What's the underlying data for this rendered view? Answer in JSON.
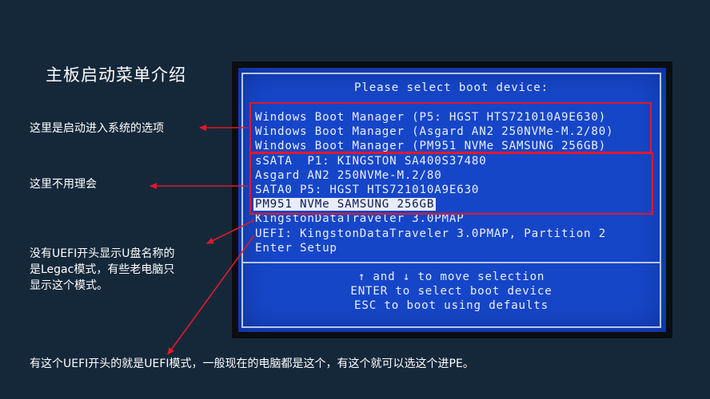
{
  "slide": {
    "title": "主板启动菜单介绍"
  },
  "annotations": {
    "system_options": "这里是启动进入系统的选项",
    "ignore": "这里不用理会",
    "legacy_line1": "没有UEFI开头显示U盘名称的",
    "legacy_line2": "是Legac模式，有些老电脑只",
    "legacy_line3": "显示这个模式。",
    "uefi_note": "有这个UEFI开头的就是UEFI模式，一般现在的电脑都是这个，有这个就可以选这个进PE。"
  },
  "bios": {
    "header": "Please select boot device:",
    "items": [
      "Windows Boot Manager (P5: HGST HTS721010A9E630)",
      "Windows Boot Manager (Asgard AN2 250NVMe-M.2/80)",
      "Windows Boot Manager (PM951 NVMe SAMSUNG 256GB)",
      "sSATA  P1: KINGSTON SA400S37480",
      "Asgard AN2 250NVMe-M.2/80",
      "SATA0 P5: HGST HTS721010A9E630",
      "PM951 NVMe SAMSUNG 256GB",
      "KingstonDataTraveler 3.0PMAP",
      "UEFI: KingstonDataTraveler 3.0PMAP, Partition 2",
      "Enter Setup"
    ],
    "selected_index": 6,
    "footer": [
      "↑ and ↓ to move selection",
      "ENTER to select boot device",
      "ESC to boot using defaults"
    ]
  },
  "colors": {
    "background": "#15283a",
    "bios_blue": "#1646c8",
    "annotation_red": "#e0192b"
  }
}
